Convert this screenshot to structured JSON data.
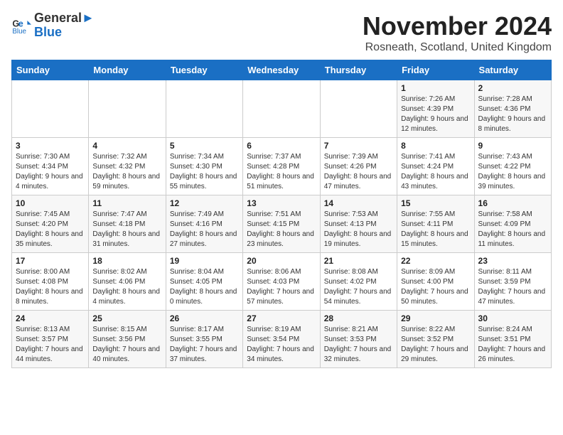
{
  "logo": {
    "line1": "General",
    "line2": "Blue"
  },
  "title": "November 2024",
  "location": "Rosneath, Scotland, United Kingdom",
  "weekdays": [
    "Sunday",
    "Monday",
    "Tuesday",
    "Wednesday",
    "Thursday",
    "Friday",
    "Saturday"
  ],
  "weeks": [
    [
      {
        "day": "",
        "info": ""
      },
      {
        "day": "",
        "info": ""
      },
      {
        "day": "",
        "info": ""
      },
      {
        "day": "",
        "info": ""
      },
      {
        "day": "",
        "info": ""
      },
      {
        "day": "1",
        "info": "Sunrise: 7:26 AM\nSunset: 4:39 PM\nDaylight: 9 hours and 12 minutes."
      },
      {
        "day": "2",
        "info": "Sunrise: 7:28 AM\nSunset: 4:36 PM\nDaylight: 9 hours and 8 minutes."
      }
    ],
    [
      {
        "day": "3",
        "info": "Sunrise: 7:30 AM\nSunset: 4:34 PM\nDaylight: 9 hours and 4 minutes."
      },
      {
        "day": "4",
        "info": "Sunrise: 7:32 AM\nSunset: 4:32 PM\nDaylight: 8 hours and 59 minutes."
      },
      {
        "day": "5",
        "info": "Sunrise: 7:34 AM\nSunset: 4:30 PM\nDaylight: 8 hours and 55 minutes."
      },
      {
        "day": "6",
        "info": "Sunrise: 7:37 AM\nSunset: 4:28 PM\nDaylight: 8 hours and 51 minutes."
      },
      {
        "day": "7",
        "info": "Sunrise: 7:39 AM\nSunset: 4:26 PM\nDaylight: 8 hours and 47 minutes."
      },
      {
        "day": "8",
        "info": "Sunrise: 7:41 AM\nSunset: 4:24 PM\nDaylight: 8 hours and 43 minutes."
      },
      {
        "day": "9",
        "info": "Sunrise: 7:43 AM\nSunset: 4:22 PM\nDaylight: 8 hours and 39 minutes."
      }
    ],
    [
      {
        "day": "10",
        "info": "Sunrise: 7:45 AM\nSunset: 4:20 PM\nDaylight: 8 hours and 35 minutes."
      },
      {
        "day": "11",
        "info": "Sunrise: 7:47 AM\nSunset: 4:18 PM\nDaylight: 8 hours and 31 minutes."
      },
      {
        "day": "12",
        "info": "Sunrise: 7:49 AM\nSunset: 4:16 PM\nDaylight: 8 hours and 27 minutes."
      },
      {
        "day": "13",
        "info": "Sunrise: 7:51 AM\nSunset: 4:15 PM\nDaylight: 8 hours and 23 minutes."
      },
      {
        "day": "14",
        "info": "Sunrise: 7:53 AM\nSunset: 4:13 PM\nDaylight: 8 hours and 19 minutes."
      },
      {
        "day": "15",
        "info": "Sunrise: 7:55 AM\nSunset: 4:11 PM\nDaylight: 8 hours and 15 minutes."
      },
      {
        "day": "16",
        "info": "Sunrise: 7:58 AM\nSunset: 4:09 PM\nDaylight: 8 hours and 11 minutes."
      }
    ],
    [
      {
        "day": "17",
        "info": "Sunrise: 8:00 AM\nSunset: 4:08 PM\nDaylight: 8 hours and 8 minutes."
      },
      {
        "day": "18",
        "info": "Sunrise: 8:02 AM\nSunset: 4:06 PM\nDaylight: 8 hours and 4 minutes."
      },
      {
        "day": "19",
        "info": "Sunrise: 8:04 AM\nSunset: 4:05 PM\nDaylight: 8 hours and 0 minutes."
      },
      {
        "day": "20",
        "info": "Sunrise: 8:06 AM\nSunset: 4:03 PM\nDaylight: 7 hours and 57 minutes."
      },
      {
        "day": "21",
        "info": "Sunrise: 8:08 AM\nSunset: 4:02 PM\nDaylight: 7 hours and 54 minutes."
      },
      {
        "day": "22",
        "info": "Sunrise: 8:09 AM\nSunset: 4:00 PM\nDaylight: 7 hours and 50 minutes."
      },
      {
        "day": "23",
        "info": "Sunrise: 8:11 AM\nSunset: 3:59 PM\nDaylight: 7 hours and 47 minutes."
      }
    ],
    [
      {
        "day": "24",
        "info": "Sunrise: 8:13 AM\nSunset: 3:57 PM\nDaylight: 7 hours and 44 minutes."
      },
      {
        "day": "25",
        "info": "Sunrise: 8:15 AM\nSunset: 3:56 PM\nDaylight: 7 hours and 40 minutes."
      },
      {
        "day": "26",
        "info": "Sunrise: 8:17 AM\nSunset: 3:55 PM\nDaylight: 7 hours and 37 minutes."
      },
      {
        "day": "27",
        "info": "Sunrise: 8:19 AM\nSunset: 3:54 PM\nDaylight: 7 hours and 34 minutes."
      },
      {
        "day": "28",
        "info": "Sunrise: 8:21 AM\nSunset: 3:53 PM\nDaylight: 7 hours and 32 minutes."
      },
      {
        "day": "29",
        "info": "Sunrise: 8:22 AM\nSunset: 3:52 PM\nDaylight: 7 hours and 29 minutes."
      },
      {
        "day": "30",
        "info": "Sunrise: 8:24 AM\nSunset: 3:51 PM\nDaylight: 7 hours and 26 minutes."
      }
    ]
  ]
}
